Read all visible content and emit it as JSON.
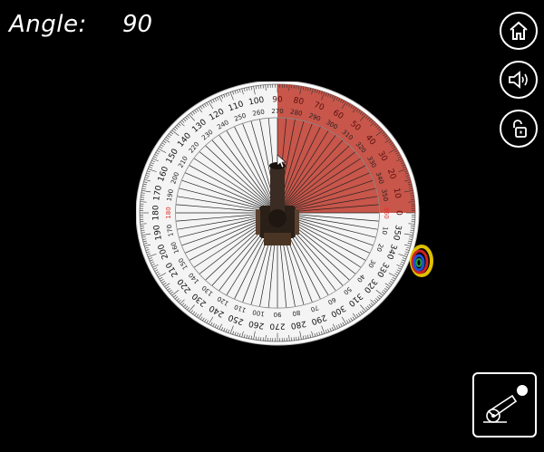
{
  "hud": {
    "angle_label": "Angle:",
    "angle_value": "90"
  },
  "protractor": {
    "outer_ticks": [
      "0",
      "10",
      "20",
      "30",
      "40",
      "50",
      "60",
      "70",
      "80",
      "90",
      "100",
      "110",
      "120",
      "130",
      "140",
      "150",
      "160",
      "170",
      "180",
      "190",
      "200",
      "210",
      "220",
      "230",
      "240",
      "250",
      "260",
      "270",
      "280",
      "290",
      "300",
      "310",
      "320",
      "330",
      "340",
      "350"
    ],
    "inner_ticks": [
      "360",
      "350",
      "340",
      "330",
      "320",
      "310",
      "300",
      "290",
      "280",
      "270",
      "260",
      "250",
      "240",
      "230",
      "220",
      "210",
      "200",
      "190",
      "180",
      "170",
      "160",
      "150",
      "140",
      "130",
      "120",
      "110",
      "100",
      "90",
      "80",
      "70",
      "60",
      "50",
      "40",
      "30",
      "20",
      "10"
    ],
    "highlight_color": "#c0392b",
    "highlight_label_color": "#e0302a",
    "highlight_start_deg": 0,
    "highlight_end_deg": 90
  },
  "buttons": {
    "home_icon": "home-icon",
    "sound_icon": "speaker-icon",
    "lock_icon": "unlock-icon",
    "fire_icon": "cannon-icon"
  }
}
